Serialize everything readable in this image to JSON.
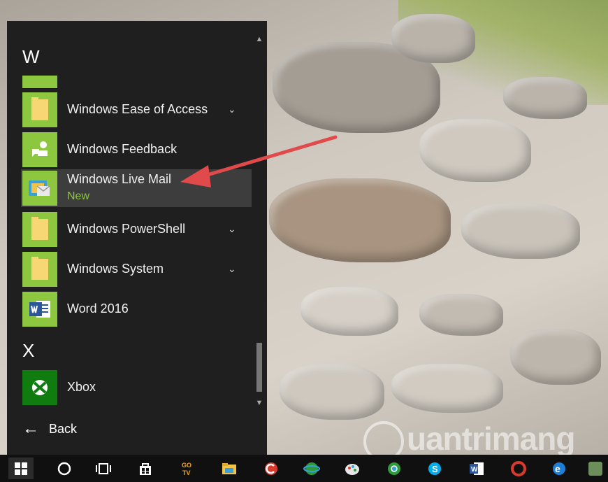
{
  "start_menu": {
    "groups": [
      {
        "letter": "W"
      },
      {
        "letter": "X"
      }
    ],
    "apps": [
      {
        "name": "Windows Ease of Access",
        "sub": "",
        "icon": "folder-icon",
        "expandable": true
      },
      {
        "name": "Windows Feedback",
        "sub": "",
        "icon": "feedback-icon",
        "expandable": false
      },
      {
        "name": "Windows Live Mail",
        "sub": "New",
        "icon": "mail-icon",
        "expandable": false
      },
      {
        "name": "Windows PowerShell",
        "sub": "",
        "icon": "folder-icon",
        "expandable": true
      },
      {
        "name": "Windows System",
        "sub": "",
        "icon": "folder-icon",
        "expandable": true
      },
      {
        "name": "Word 2016",
        "sub": "",
        "icon": "word-icon",
        "expandable": false
      },
      {
        "name": "Xbox",
        "sub": "",
        "icon": "xbox-icon",
        "expandable": false
      }
    ],
    "back_label": "Back",
    "chevron_glyph": "⌄",
    "back_glyph": "←"
  },
  "taskbar": {
    "items": [
      "windows-start-icon",
      "cortana-icon",
      "task-view-icon",
      "store-icon",
      "gotv-icon",
      "file-explorer-icon",
      "ccleaner-icon",
      "ie-green-icon",
      "paint-icon",
      "chrome-icon",
      "skype-icon",
      "word-icon",
      "opera-icon",
      "edge-icon",
      "app-icon"
    ]
  },
  "watermark": {
    "text": "uantrimang"
  },
  "colors": {
    "tile_green": "#8dc63f",
    "xbox_green": "#107c10",
    "menu_bg": "#1f1f1f",
    "selected_bg": "#3d3d3d",
    "annotation_red": "#e04a4a"
  }
}
